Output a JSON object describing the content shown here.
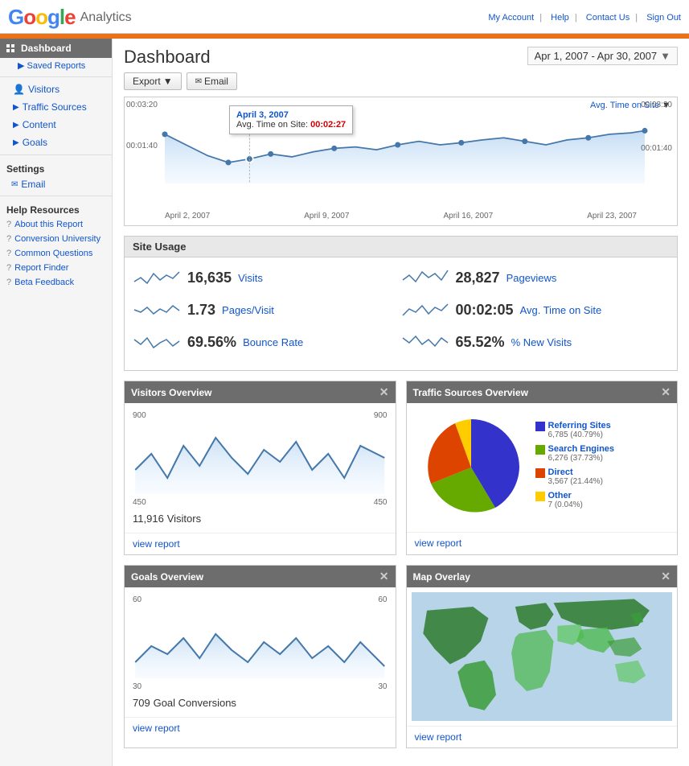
{
  "header": {
    "logo": "Google Analytics",
    "nav": {
      "my_account": "My Account",
      "help": "Help",
      "contact_us": "Contact Us",
      "sign_out": "Sign Out"
    }
  },
  "sidebar": {
    "dashboard_label": "Dashboard",
    "saved_reports": "Saved Reports",
    "nav_items": [
      {
        "id": "visitors",
        "label": "Visitors"
      },
      {
        "id": "traffic-sources",
        "label": "Traffic Sources"
      },
      {
        "id": "content",
        "label": "Content"
      },
      {
        "id": "goals",
        "label": "Goals"
      }
    ],
    "settings": {
      "label": "Settings",
      "email": "Email"
    },
    "help": {
      "label": "Help Resources",
      "items": [
        "About this Report",
        "Conversion University",
        "Common Questions",
        "Report Finder",
        "Beta Feedback"
      ]
    }
  },
  "dashboard": {
    "title": "Dashboard",
    "date_range": "Apr 1, 2007 - Apr 30, 2007",
    "export_label": "Export",
    "email_label": "Email",
    "chart": {
      "metric_label": "Avg. Time on Site",
      "y_top": "00:03:20",
      "y_mid": "00:01:40",
      "y_top_right": "00:03:20",
      "y_mid_right": "00:01:40",
      "x_labels": [
        "April 2, 2007",
        "April 9, 2007",
        "April 16, 2007",
        "April 23, 2007"
      ],
      "tooltip": {
        "date": "April 3, 2007",
        "label": "Avg. Time on Site:",
        "value": "00:02:27"
      }
    },
    "site_usage": {
      "title": "Site Usage",
      "metrics": [
        {
          "value": "16,635",
          "label": "Visits"
        },
        {
          "value": "28,827",
          "label": "Pageviews"
        },
        {
          "value": "1.73",
          "label": "Pages/Visit"
        },
        {
          "value": "00:02:05",
          "label": "Avg. Time on Site"
        },
        {
          "value": "69.56%",
          "label": "Bounce Rate"
        },
        {
          "value": "65.52%",
          "label": "% New Visits"
        }
      ]
    },
    "visitors_overview": {
      "title": "Visitors Overview",
      "count": "11,916",
      "count_label": "Visitors",
      "view_report": "view report",
      "y_labels": [
        "900",
        "450"
      ]
    },
    "traffic_sources": {
      "title": "Traffic Sources Overview",
      "view_report": "view report",
      "segments": [
        {
          "name": "Referring Sites",
          "value": "6,785",
          "pct": "40.79%",
          "color": "#3333cc",
          "slice_deg": 147
        },
        {
          "name": "Search Engines",
          "value": "6,276",
          "pct": "37.73%",
          "color": "#66aa00",
          "slice_deg": 136
        },
        {
          "name": "Direct",
          "value": "3,567",
          "pct": "21.44%",
          "color": "#dd4400",
          "slice_deg": 77
        },
        {
          "name": "Other",
          "value": "7",
          "pct": "0.04%",
          "color": "#ffcc00",
          "slice_deg": 0
        }
      ]
    },
    "goals_overview": {
      "title": "Goals Overview",
      "count": "709",
      "count_label": "Goal Conversions",
      "view_report": "view report",
      "y_labels": [
        "60",
        "30"
      ]
    },
    "map_overlay": {
      "title": "Map Overlay",
      "view_report": "view report"
    }
  }
}
